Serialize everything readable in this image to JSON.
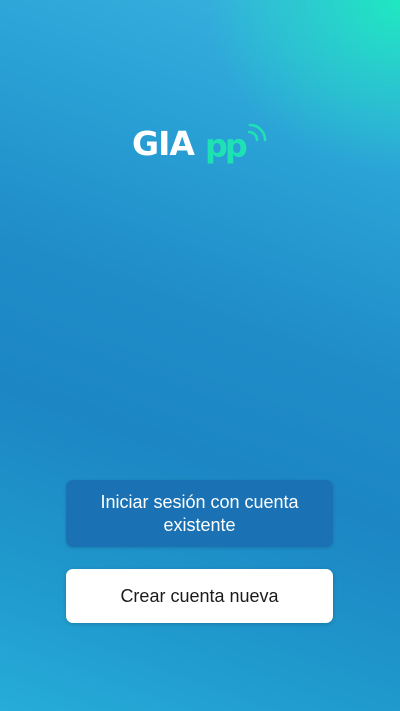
{
  "brand": {
    "logo_main": "GIA",
    "logo_accent": "pp",
    "icon": "signal-waves-icon",
    "primary_color": "#ffffff",
    "accent_color": "#1ee2b4"
  },
  "background": {
    "gradient_colors": [
      "#1ee8c0",
      "#3bb4e0",
      "#1f8cc8",
      "#26acd8"
    ]
  },
  "actions": {
    "login_label": "Iniciar sesión con cuenta existente",
    "create_label": "Crear cuenta nueva",
    "login_color": "#1a72b4",
    "create_color": "#ffffff"
  }
}
